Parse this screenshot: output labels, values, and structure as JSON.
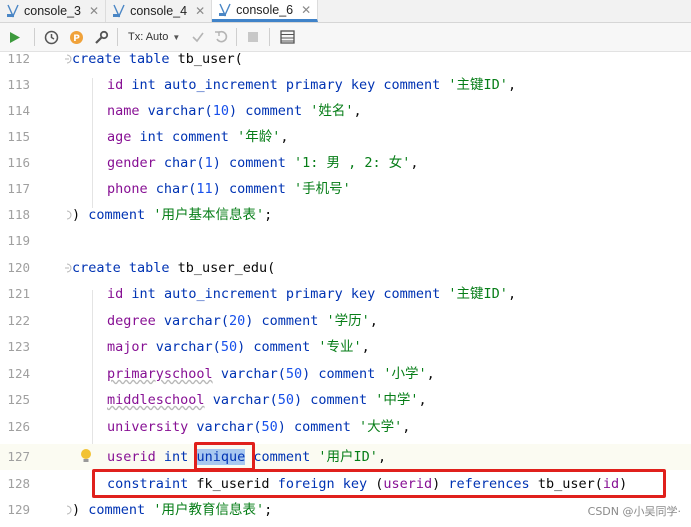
{
  "tabs": [
    {
      "label": "console_3"
    },
    {
      "label": "console_4"
    },
    {
      "label": "console_6",
      "active": true
    }
  ],
  "toolbar": {
    "tx_label": "Tx: Auto"
  },
  "lines": [
    {
      "n": "112"
    },
    {
      "n": "113"
    },
    {
      "n": "114"
    },
    {
      "n": "115"
    },
    {
      "n": "116"
    },
    {
      "n": "117"
    },
    {
      "n": "118"
    },
    {
      "n": "119"
    },
    {
      "n": "120"
    },
    {
      "n": "121"
    },
    {
      "n": "122"
    },
    {
      "n": "123"
    },
    {
      "n": "124"
    },
    {
      "n": "125"
    },
    {
      "n": "126"
    },
    {
      "n": "127"
    },
    {
      "n": "128"
    },
    {
      "n": "129"
    }
  ],
  "code": {
    "l112": {
      "a": "create table ",
      "b": "tb_user("
    },
    "l113": {
      "col": "id",
      "t": "int",
      "kw": "auto_increment primary key comment",
      "s": "'主键ID'",
      "p": ","
    },
    "l114": {
      "col": "name",
      "t": "varchar(",
      "n": "10",
      "t2": ") comment",
      "s": "'姓名'",
      "p": ","
    },
    "l115": {
      "col": "age",
      "t": "int comment",
      "s": "'年龄'",
      "p": ","
    },
    "l116": {
      "col": "gender",
      "t": "char(",
      "n": "1",
      "t2": ") comment",
      "s": "'1: 男 , 2: 女'",
      "p": ","
    },
    "l117": {
      "col": "phone",
      "t": "char(",
      "n": "11",
      "t2": ") comment",
      "s": "'手机号'"
    },
    "l118": {
      "a": ") ",
      "kw": "comment",
      "s": "'用户基本信息表'",
      "p": ";"
    },
    "l120": {
      "a": "create table ",
      "b": "tb_user_edu("
    },
    "l121": {
      "col": "id",
      "t": "int",
      "kw": "auto_increment primary key comment",
      "s": "'主键ID'",
      "p": ","
    },
    "l122": {
      "col": "degree",
      "t": "varchar(",
      "n": "20",
      "t2": ") comment",
      "s": "'学历'",
      "p": ","
    },
    "l123": {
      "col": "major",
      "t": "varchar(",
      "n": "50",
      "t2": ") comment",
      "s": "'专业'",
      "p": ","
    },
    "l124": {
      "col": "primaryschool",
      "t": "varchar(",
      "n": "50",
      "t2": ") comment",
      "s": "'小学'",
      "p": ","
    },
    "l125": {
      "col": "middleschool",
      "t": "varchar(",
      "n": "50",
      "t2": ") comment",
      "s": "'中学'",
      "p": ","
    },
    "l126": {
      "col": "university",
      "t": "varchar(",
      "n": "50",
      "t2": ") comment",
      "s": "'大学'",
      "p": ","
    },
    "l127": {
      "col": "userid",
      "t": "int",
      "u": "unique",
      "t2": "comment",
      "s": "'用户ID'",
      "p": ","
    },
    "l128": {
      "a": "constraint ",
      "b": "fk_userid ",
      "kw": "foreign key",
      "c": " (",
      "col": "userid",
      "d": ") ",
      "kw2": "references ",
      "e": "tb_user(",
      "col2": "id",
      "f": ")"
    },
    "l129": {
      "a": ") ",
      "kw": "comment",
      "s": "'用户教育信息表'",
      "p": ";"
    }
  },
  "watermark": "CSDN @小吴同学·",
  "colors": {
    "keyword": "#0033b3",
    "string": "#067d17",
    "number": "#1750eb",
    "column": "#871094",
    "highlight_box": "#e0201c",
    "selection": "#a8c8f0"
  }
}
